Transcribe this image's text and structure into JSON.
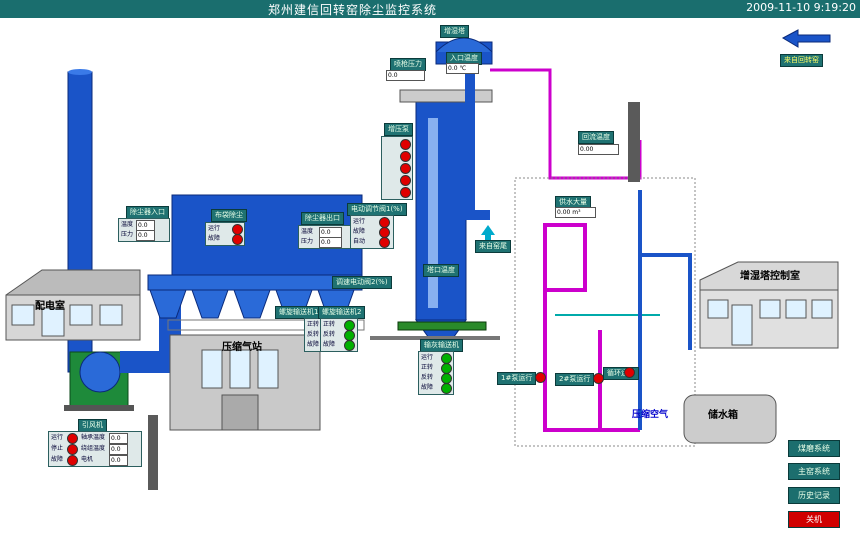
{
  "title": "郑州建信回转窑除尘监控系统",
  "clock": "2009-11-10 9:19:20",
  "labels": {
    "kiln_return": "来自回转窑",
    "tower_top": "增湿塔",
    "inlet_temp": "入口温度",
    "spray_pressure": "喷枪压力",
    "pump_valves": "增压泵",
    "return_temp": "回流温度",
    "water_supply": "供水大量",
    "bag_inlet": "除尘器入口",
    "bag_main": "布袋除尘",
    "bag_outlet": "除尘器出口",
    "elec_valve": "电动调节阀1(%)",
    "tower_outlet": "塔口温度",
    "flow_valve": "调速电动阀2(%)",
    "screw1": "螺旋输送机1",
    "screw2": "螺旋输送机2",
    "ash_conveyor": "输灰输送机",
    "fan": "引风机",
    "kiln_exhaust": "来自窑尾",
    "power_room": "配电室",
    "compressor": "压缩气站",
    "tower_control": "增湿塔控制室",
    "water_tank": "储水箱",
    "compressed_air": "压缩空气",
    "pump1": "1#泵运行",
    "pump2": "2#泵运行",
    "recirc": "循环运行"
  },
  "small": {
    "run": "运行",
    "stop": "停止",
    "fault": "故障",
    "auto": "自动",
    "temp": "温度",
    "pressure": "压力",
    "fwd": "正转",
    "rev": "反转",
    "current": "电流",
    "freq": "频率",
    "bearing": "轴承温度",
    "winding": "绕组温度",
    "motor": "电机"
  },
  "values": {
    "inlet_temp": "0.0  ℃",
    "spray_pressure": "0.0",
    "return_temp": "0.00",
    "water_supply": "0.00 m³",
    "inlet_t1": "0.0",
    "inlet_t2": "0.0",
    "outlet_t1": "0.0",
    "outlet_t2": "0.0",
    "fan_i": "0.0",
    "fan_f": "0.0",
    "fan_b": "0.0"
  },
  "units": {
    "c": "℃",
    "pa": "Pa",
    "a": "A",
    "hz": "Hz"
  },
  "buttons": [
    {
      "label": "煤磨系统",
      "alert": false
    },
    {
      "label": "主窑系统",
      "alert": false
    },
    {
      "label": "历史记录",
      "alert": false
    },
    {
      "label": "关机",
      "alert": true
    }
  ]
}
